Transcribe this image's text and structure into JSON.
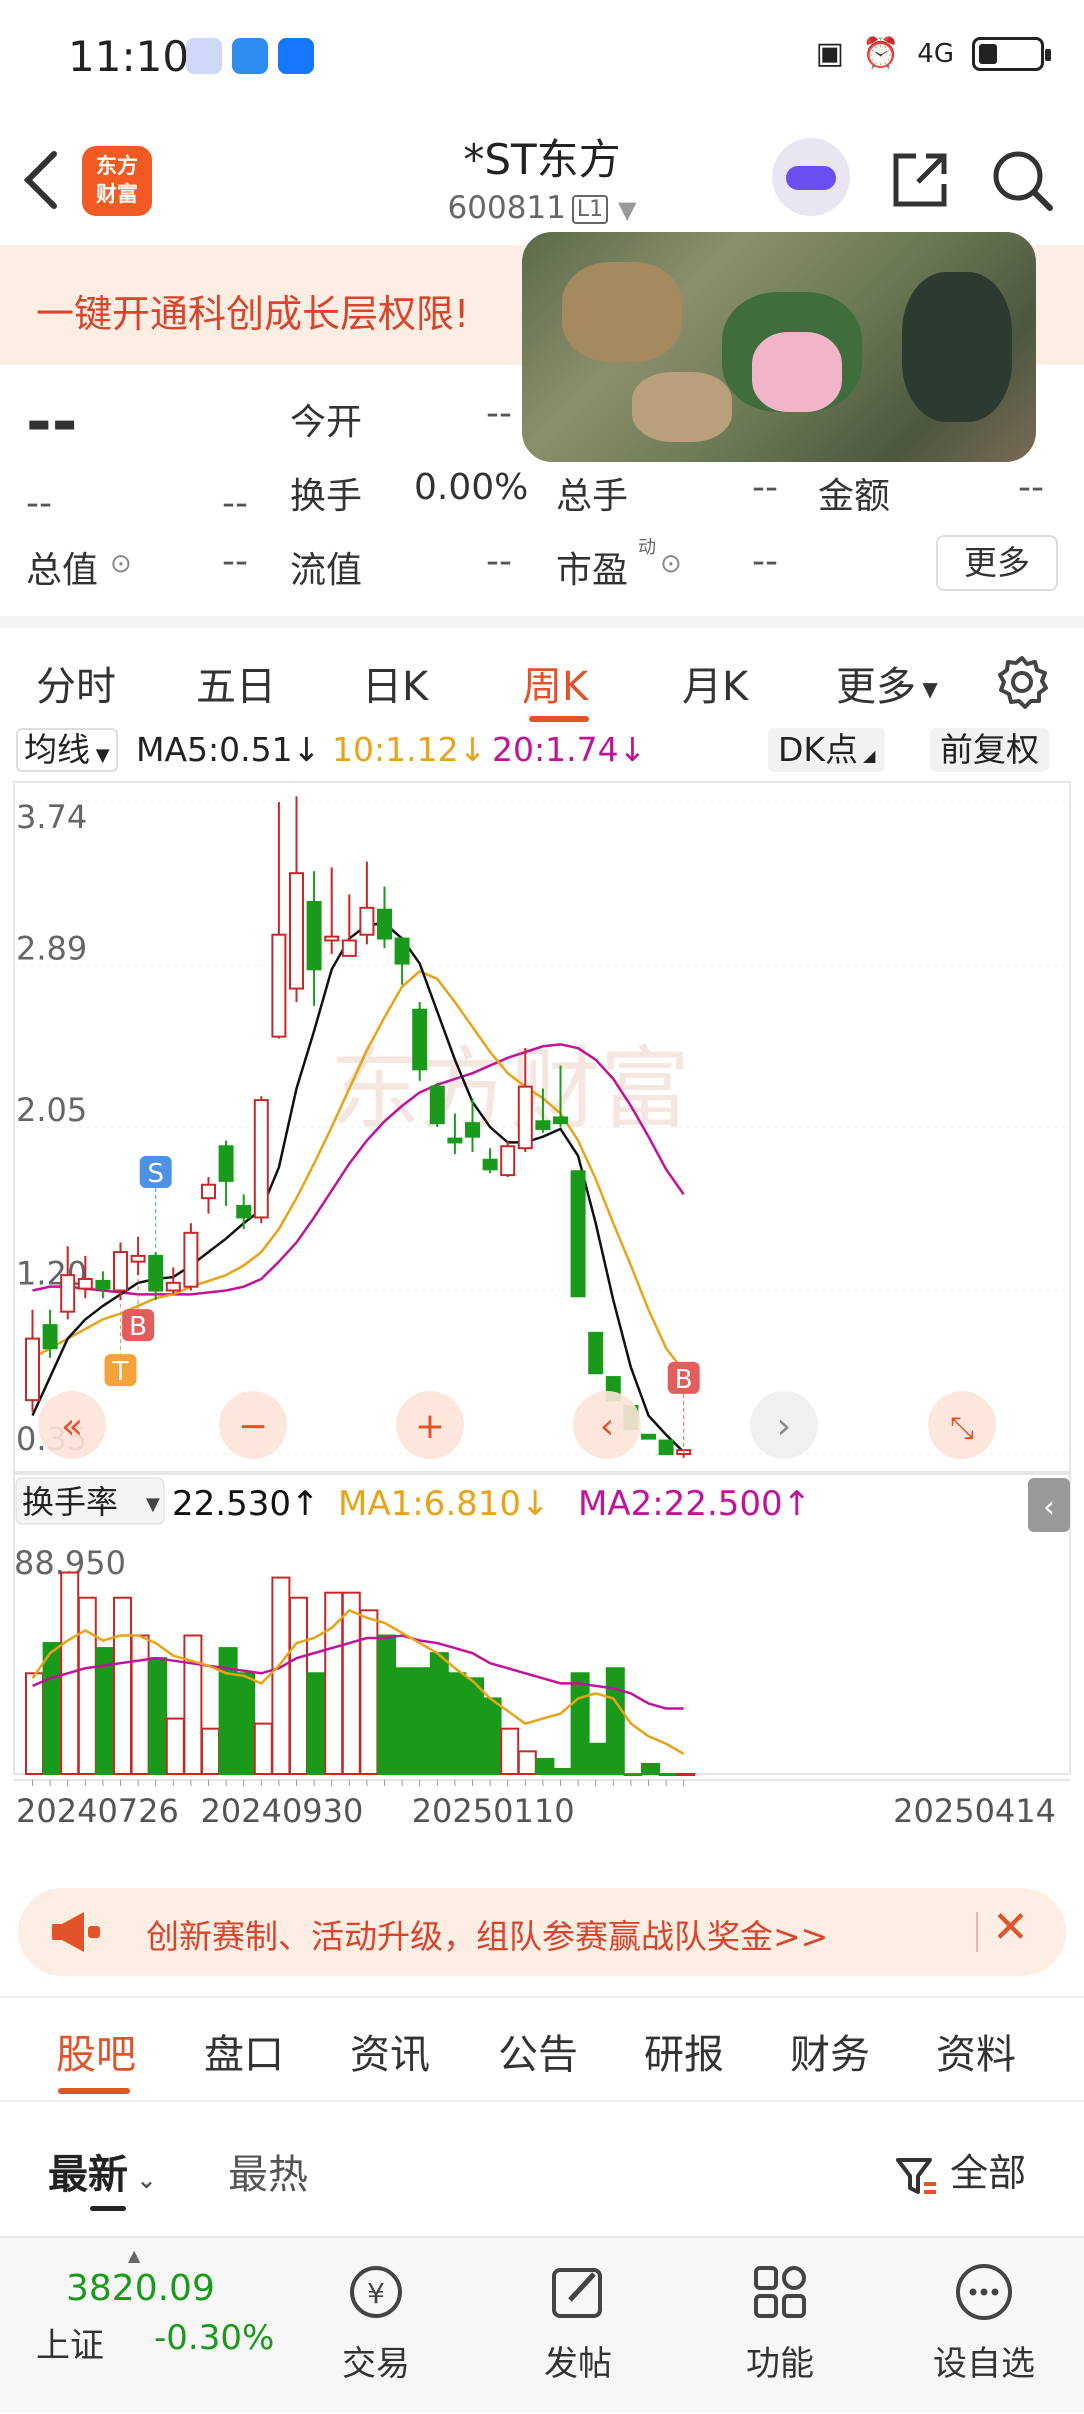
{
  "status_bar": {
    "time": "11:10",
    "signal": "4G"
  },
  "header": {
    "back_icon": "chevron-left-icon",
    "logo_text_line1": "东方",
    "logo_text_line2": "财富",
    "title": "*ST东方",
    "code": "600811",
    "level": "L1"
  },
  "banner": {
    "text": "一键开通科创成长层权限!"
  },
  "quote": {
    "price": "--",
    "change": "--",
    "change_pct": "--",
    "open_label": "今开",
    "open_value": "--",
    "turnover_label": "换手",
    "turnover_value": "0.00%",
    "volume_label": "总手",
    "volume_value": "--",
    "amount_label": "金额",
    "amount_value": "--",
    "mktcap_label": "总值",
    "mktcap_value": "--",
    "float_label": "流值",
    "float_value": "--",
    "pe_label": "市盈",
    "pe_sup": "动",
    "pe_value": "--",
    "more_label": "更多"
  },
  "tabs": [
    "分时",
    "五日",
    "日K",
    "周K",
    "月K",
    "更多"
  ],
  "active_tab": "周K",
  "ma_row": {
    "selector": "均线",
    "ma5": "MA5:0.51↓",
    "ma10": "10:1.12↓",
    "ma20": "20:1.74↓",
    "dk_label": "DK点",
    "adjust_label": "前复权"
  },
  "turnover_row": {
    "selector": "换手率",
    "value": "22.530↑",
    "ma1": "MA1:6.810↓",
    "ma2": "MA2:22.500↑"
  },
  "colors": {
    "up": "#c62828",
    "down": "#1a9a1a",
    "ma5": "#111111",
    "ma10": "#e8a317",
    "ma20": "#c0139a",
    "accent": "#e2532a"
  },
  "chart_data": {
    "type": "candlestick",
    "price_axis": {
      "ticks": [
        "3.74",
        "2.89",
        "2.05",
        "1.20",
        "0.35"
      ],
      "ylim": [
        0.35,
        3.74
      ]
    },
    "turnover_axis": {
      "max_label": "88.950",
      "ylim": [
        0,
        88.95
      ]
    },
    "x_labels": [
      "20240726",
      "20240930",
      "20250110",
      "20250414"
    ],
    "candles": [
      {
        "o": 0.63,
        "c": 0.95,
        "h": 1.1,
        "l": 0.57
      },
      {
        "o": 1.02,
        "c": 0.9,
        "h": 1.1,
        "l": 0.85
      },
      {
        "o": 1.09,
        "c": 1.28,
        "h": 1.43,
        "l": 1.05
      },
      {
        "o": 1.21,
        "c": 1.26,
        "h": 1.38,
        "l": 1.16
      },
      {
        "o": 1.25,
        "c": 1.21,
        "h": 1.3,
        "l": 1.16
      },
      {
        "o": 1.2,
        "c": 1.4,
        "h": 1.45,
        "l": 1.15
      },
      {
        "o": 1.35,
        "c": 1.38,
        "h": 1.48,
        "l": 1.28
      },
      {
        "o": 1.38,
        "c": 1.2,
        "h": 1.4,
        "l": 1.15
      },
      {
        "o": 1.2,
        "c": 1.24,
        "h": 1.32,
        "l": 1.18
      },
      {
        "o": 1.22,
        "c": 1.5,
        "h": 1.55,
        "l": 1.2
      },
      {
        "o": 1.68,
        "c": 1.75,
        "h": 1.79,
        "l": 1.6
      },
      {
        "o": 1.95,
        "c": 1.77,
        "h": 1.98,
        "l": 1.64
      },
      {
        "o": 1.64,
        "c": 1.58,
        "h": 1.7,
        "l": 1.52
      },
      {
        "o": 1.58,
        "c": 2.19,
        "h": 2.21,
        "l": 1.55
      },
      {
        "o": 2.52,
        "c": 3.05,
        "h": 3.74,
        "l": 2.51
      },
      {
        "o": 2.77,
        "c": 3.37,
        "h": 3.77,
        "l": 2.7
      },
      {
        "o": 3.22,
        "c": 2.87,
        "h": 3.38,
        "l": 2.68
      },
      {
        "o": 3.02,
        "c": 3.04,
        "h": 3.4,
        "l": 2.95
      },
      {
        "o": 2.94,
        "c": 3.02,
        "h": 3.26,
        "l": 2.94
      },
      {
        "o": 3.05,
        "c": 3.19,
        "h": 3.43,
        "l": 3.0
      },
      {
        "o": 3.18,
        "c": 3.03,
        "h": 3.3,
        "l": 2.98
      },
      {
        "o": 3.03,
        "c": 2.9,
        "h": 3.04,
        "l": 2.79
      },
      {
        "o": 2.66,
        "c": 2.35,
        "h": 2.7,
        "l": 2.29
      },
      {
        "o": 2.26,
        "c": 2.07,
        "h": 2.28,
        "l": 2.05
      },
      {
        "o": 1.99,
        "c": 1.97,
        "h": 2.12,
        "l": 1.91
      },
      {
        "o": 2.07,
        "c": 2.0,
        "h": 2.2,
        "l": 1.92
      },
      {
        "o": 1.88,
        "c": 1.83,
        "h": 1.94,
        "l": 1.81
      },
      {
        "o": 1.8,
        "c": 1.95,
        "h": 1.98,
        "l": 1.79
      },
      {
        "o": 1.94,
        "c": 2.26,
        "h": 2.46,
        "l": 1.92
      },
      {
        "o": 2.08,
        "c": 2.04,
        "h": 2.25,
        "l": 2.02
      },
      {
        "o": 2.1,
        "c": 2.07,
        "h": 2.37,
        "l": 2.05
      },
      {
        "o": 1.82,
        "c": 1.17,
        "h": 1.82,
        "l": 1.17
      },
      {
        "o": 0.98,
        "c": 0.77,
        "h": 0.98,
        "l": 0.77
      },
      {
        "o": 0.75,
        "c": 0.63,
        "h": 0.75,
        "l": 0.63
      },
      {
        "o": 0.6,
        "c": 0.48,
        "h": 0.6,
        "l": 0.48
      },
      {
        "o": 0.45,
        "c": 0.43,
        "h": 0.45,
        "l": 0.43
      },
      {
        "o": 0.42,
        "c": 0.35,
        "h": 0.42,
        "l": 0.35
      },
      {
        "o": 0.35,
        "c": 0.37,
        "h": 0.37,
        "l": 0.33
      }
    ],
    "ma5": [
      0.55,
      0.75,
      0.95,
      1.05,
      1.12,
      1.18,
      1.24,
      1.26,
      1.27,
      1.33,
      1.4,
      1.47,
      1.55,
      1.62,
      1.84,
      2.25,
      2.55,
      2.87,
      3.03,
      3.1,
      3.11,
      3.03,
      2.9,
      2.65,
      2.4,
      2.18,
      2.05,
      1.97,
      1.97,
      2.0,
      2.04,
      1.9,
      1.55,
      1.15,
      0.8,
      0.55,
      0.45,
      0.36
    ],
    "ma10": [
      0.85,
      0.9,
      0.95,
      1.0,
      1.05,
      1.08,
      1.12,
      1.16,
      1.18,
      1.22,
      1.25,
      1.28,
      1.33,
      1.4,
      1.52,
      1.68,
      1.86,
      2.05,
      2.25,
      2.45,
      2.62,
      2.78,
      2.86,
      2.82,
      2.7,
      2.57,
      2.44,
      2.33,
      2.26,
      2.2,
      2.12,
      1.98,
      1.78,
      1.55,
      1.33,
      1.1,
      0.9,
      0.78
    ],
    "ma20": [
      1.2,
      1.22,
      1.22,
      1.21,
      1.2,
      1.19,
      1.18,
      1.18,
      1.18,
      1.18,
      1.19,
      1.2,
      1.22,
      1.26,
      1.35,
      1.45,
      1.58,
      1.72,
      1.86,
      1.98,
      2.08,
      2.16,
      2.23,
      2.27,
      2.3,
      2.33,
      2.37,
      2.41,
      2.44,
      2.47,
      2.48,
      2.46,
      2.4,
      2.3,
      2.16,
      2.0,
      1.83,
      1.7
    ],
    "turnover": [
      40,
      52,
      80,
      70,
      50,
      70,
      55,
      46,
      22,
      55,
      18,
      50,
      40,
      20,
      78,
      70,
      40,
      72,
      72,
      65,
      55,
      42,
      42,
      48,
      40,
      38,
      30,
      18,
      9,
      6,
      2,
      40,
      12,
      42,
      0,
      4,
      0,
      0
    ],
    "turnover_ma1": [
      38,
      48,
      53,
      57,
      53,
      55,
      55,
      52,
      47,
      45,
      43,
      40,
      39,
      36,
      43,
      52,
      54,
      58,
      65,
      62,
      60,
      56,
      52,
      48,
      42,
      37,
      30,
      25,
      20,
      22,
      24,
      30,
      32,
      30,
      20,
      15,
      12,
      8
    ],
    "turnover_ma2": [
      35,
      38,
      40,
      42,
      43,
      44,
      45,
      46,
      45,
      44,
      43,
      42,
      41,
      40,
      42,
      46,
      48,
      50,
      52,
      54,
      54,
      55,
      53,
      52,
      50,
      48,
      44,
      42,
      40,
      38,
      36,
      36,
      35,
      34,
      32,
      28,
      26,
      26
    ],
    "markers": [
      {
        "label": "S",
        "index": 7,
        "color": "#4e92e6"
      },
      {
        "label": "T",
        "index": 5,
        "color": "#f3a33a"
      },
      {
        "label": "B",
        "index": 6,
        "color": "#e45d5d"
      },
      {
        "label": "B",
        "index": 37,
        "color": "#e45d5d"
      }
    ]
  },
  "promo": {
    "text": "创新赛制、活动升级，组队参赛赢战队奖金>>"
  },
  "subtabs": [
    "股吧",
    "盘口",
    "资讯",
    "公告",
    "研报",
    "财务",
    "资料"
  ],
  "active_subtab": "股吧",
  "filter": {
    "latest": "最新",
    "hot": "最热",
    "all": "全部"
  },
  "bottom_bar": {
    "index_value": "3820.09",
    "index_name": "上证",
    "index_change": "-0.30%",
    "items": [
      {
        "label": "交易",
        "icon": "trade-icon"
      },
      {
        "label": "发帖",
        "icon": "post-icon"
      },
      {
        "label": "功能",
        "icon": "grid-icon"
      },
      {
        "label": "设自选",
        "icon": "more-circle-icon"
      }
    ]
  }
}
